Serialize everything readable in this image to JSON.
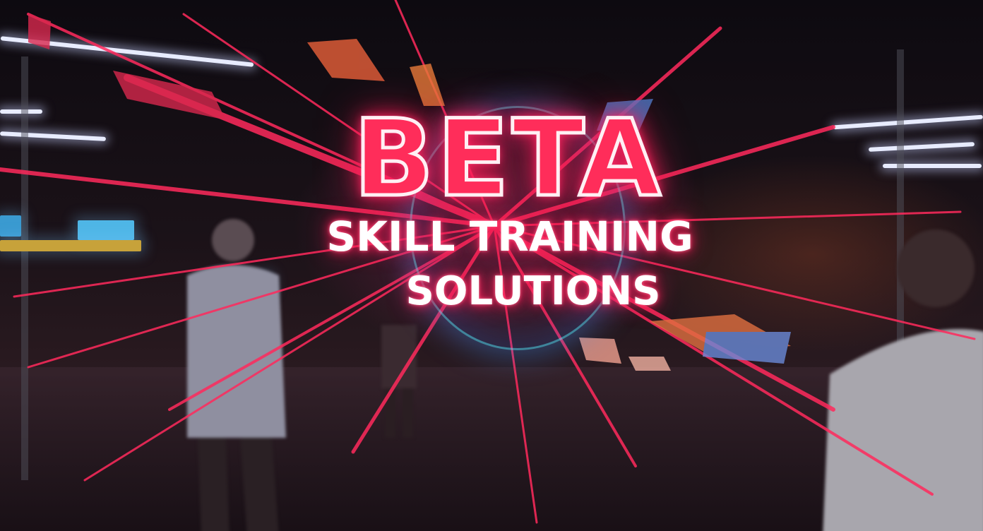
{
  "headline": {
    "word": "BETA",
    "line1": "SKILL TRAINING",
    "line2": "SOLUTIONS"
  },
  "colors": {
    "neon_pink": "#ff2d5a",
    "glow_blue": "#50dcff",
    "background": "#120c14"
  }
}
